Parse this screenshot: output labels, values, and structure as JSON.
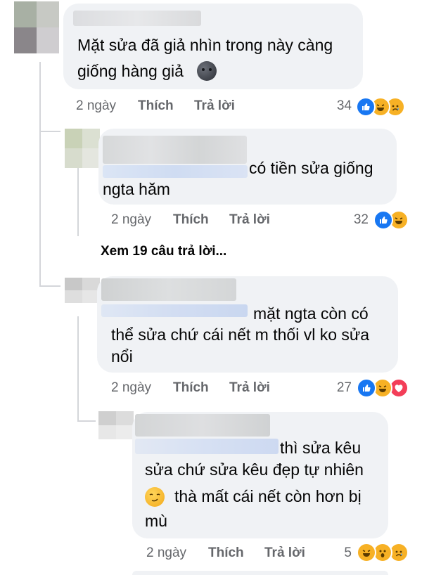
{
  "comments": [
    {
      "text_lines": [
        "Mặt sửa đã giả nhìn trong này càng",
        "giống hàng giả"
      ],
      "emoji": "dark-moon-face",
      "time": "2 ngày",
      "like_label": "Thích",
      "reply_label": "Trả lời",
      "reaction_count": "34",
      "reactions": [
        "like",
        "haha",
        "sad"
      ]
    },
    {
      "text_lines": [
        "có tiền sửa giống",
        "ngta hăm"
      ],
      "time": "2 ngày",
      "like_label": "Thích",
      "reply_label": "Trả lời",
      "reaction_count": "32",
      "reactions": [
        "like",
        "haha"
      ]
    },
    {
      "text_lines": [
        "mặt ngta còn có",
        "thể sửa chứ cái nết m thối vl ko sửa",
        "nổi"
      ],
      "time": "2 ngày",
      "like_label": "Thích",
      "reply_label": "Trả lời",
      "reaction_count": "27",
      "reactions": [
        "like",
        "haha",
        "love"
      ]
    },
    {
      "text_lines": [
        "thì sửa kêu",
        "sửa chứ sửa kêu đẹp tự nhiên",
        "thà mất cái nết còn hơn bị",
        "mù"
      ],
      "emoji": "smirking-face",
      "time": "2 ngày",
      "like_label": "Thích",
      "reply_label": "Trả lời",
      "reaction_count": "5",
      "reactions": [
        "haha",
        "wow",
        "sad"
      ]
    }
  ],
  "view_more_replies": "Xem 19 câu trả lời...",
  "colors": {
    "bubble": "#f0f2f5",
    "text": "#050505",
    "meta": "#65676b",
    "like": "#1877f2",
    "love": "#f33e58",
    "emoji_yellow": "#f7b125"
  }
}
